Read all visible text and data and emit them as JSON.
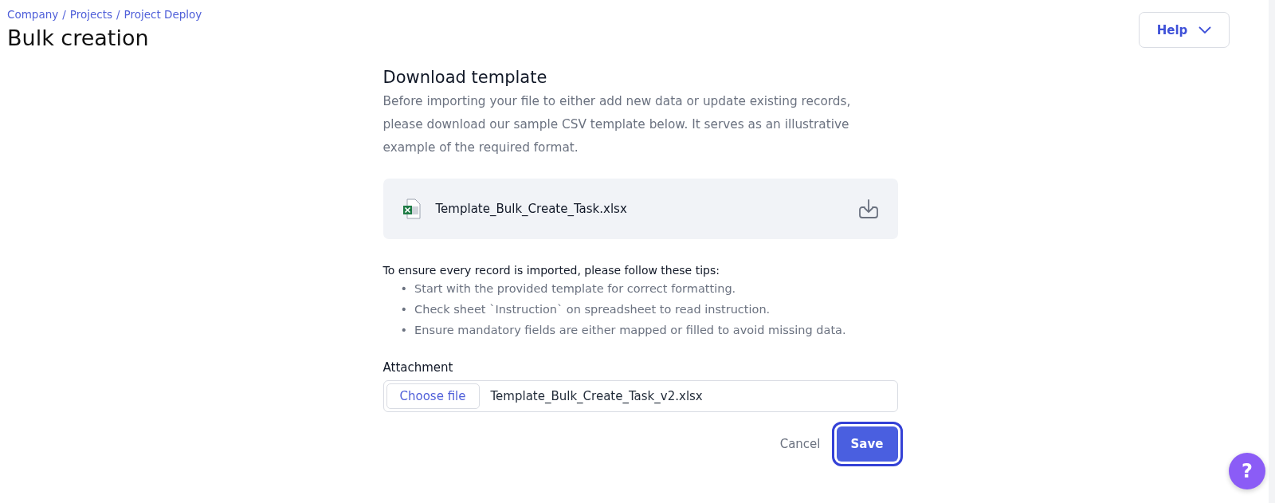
{
  "breadcrumbs": [
    "Company",
    "Projects",
    "Project Deploy"
  ],
  "breadcrumb_separator": "/",
  "tip_bullet": "•",
  "page_title": "Bulk creation",
  "help_button": {
    "label": "Help"
  },
  "section": {
    "title": "Download template",
    "description": "Before importing your file to either add new data or update existing records, please download our sample CSV template below. It serves as an illustrative example of the required format."
  },
  "template_file": {
    "name": "Template_Bulk_Create_Task.xlsx"
  },
  "tips": {
    "heading": "To ensure every record is imported, please follow these tips:",
    "items": [
      "Start with the provided template for correct formatting.",
      "Check sheet `Instruction` on spreadsheet to read instruction.",
      "Ensure mandatory fields are either mapped or filled to avoid missing data."
    ]
  },
  "attachment": {
    "label": "Attachment",
    "button": "Choose file",
    "value": "Template_Bulk_Create_Task_v2.xlsx"
  },
  "actions": {
    "cancel": "Cancel",
    "save": "Save",
    "save_focused": true
  },
  "floating_help": {
    "label": "?"
  }
}
